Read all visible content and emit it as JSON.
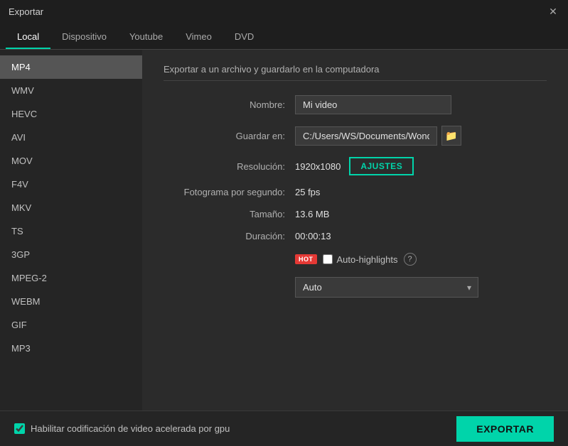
{
  "titlebar": {
    "title": "Exportar"
  },
  "tabs": [
    {
      "id": "local",
      "label": "Local",
      "active": true
    },
    {
      "id": "dispositivo",
      "label": "Dispositivo",
      "active": false
    },
    {
      "id": "youtube",
      "label": "Youtube",
      "active": false
    },
    {
      "id": "vimeo",
      "label": "Vimeo",
      "active": false
    },
    {
      "id": "dvd",
      "label": "DVD",
      "active": false
    }
  ],
  "sidebar": {
    "items": [
      {
        "id": "mp4",
        "label": "MP4",
        "active": true
      },
      {
        "id": "wmv",
        "label": "WMV",
        "active": false
      },
      {
        "id": "hevc",
        "label": "HEVC",
        "active": false
      },
      {
        "id": "avi",
        "label": "AVI",
        "active": false
      },
      {
        "id": "mov",
        "label": "MOV",
        "active": false
      },
      {
        "id": "f4v",
        "label": "F4V",
        "active": false
      },
      {
        "id": "mkv",
        "label": "MKV",
        "active": false
      },
      {
        "id": "ts",
        "label": "TS",
        "active": false
      },
      {
        "id": "3gp",
        "label": "3GP",
        "active": false
      },
      {
        "id": "mpeg2",
        "label": "MPEG-2",
        "active": false
      },
      {
        "id": "webm",
        "label": "WEBM",
        "active": false
      },
      {
        "id": "gif",
        "label": "GIF",
        "active": false
      },
      {
        "id": "mp3",
        "label": "MP3",
        "active": false
      }
    ]
  },
  "content": {
    "description": "Exportar a un archivo y guardarlo en la computadora",
    "fields": {
      "nombre_label": "Nombre:",
      "nombre_value": "Mi video",
      "guardar_label": "Guardar en:",
      "guardar_value": "C:/Users/WS/Documents/Wonders",
      "resolucion_label": "Resolución:",
      "resolucion_value": "1920x1080",
      "ajustes_label": "AJUSTES",
      "fotograma_label": "Fotograma por segundo:",
      "fotograma_value": "25 fps",
      "tamanio_label": "Tamaño:",
      "tamanio_value": "13.6 MB",
      "duracion_label": "Duración:",
      "duracion_value": "00:00:13",
      "hot_badge": "HOT",
      "auto_highlights_label": "Auto-highlights",
      "auto_select_default": "Auto",
      "help_symbol": "?"
    }
  },
  "bottombar": {
    "gpu_label": "Habilitar codificación de video acelerada por gpu",
    "export_label": "EXPORTAR"
  },
  "icons": {
    "close": "✕",
    "folder": "📁",
    "chevron_down": "▾"
  }
}
